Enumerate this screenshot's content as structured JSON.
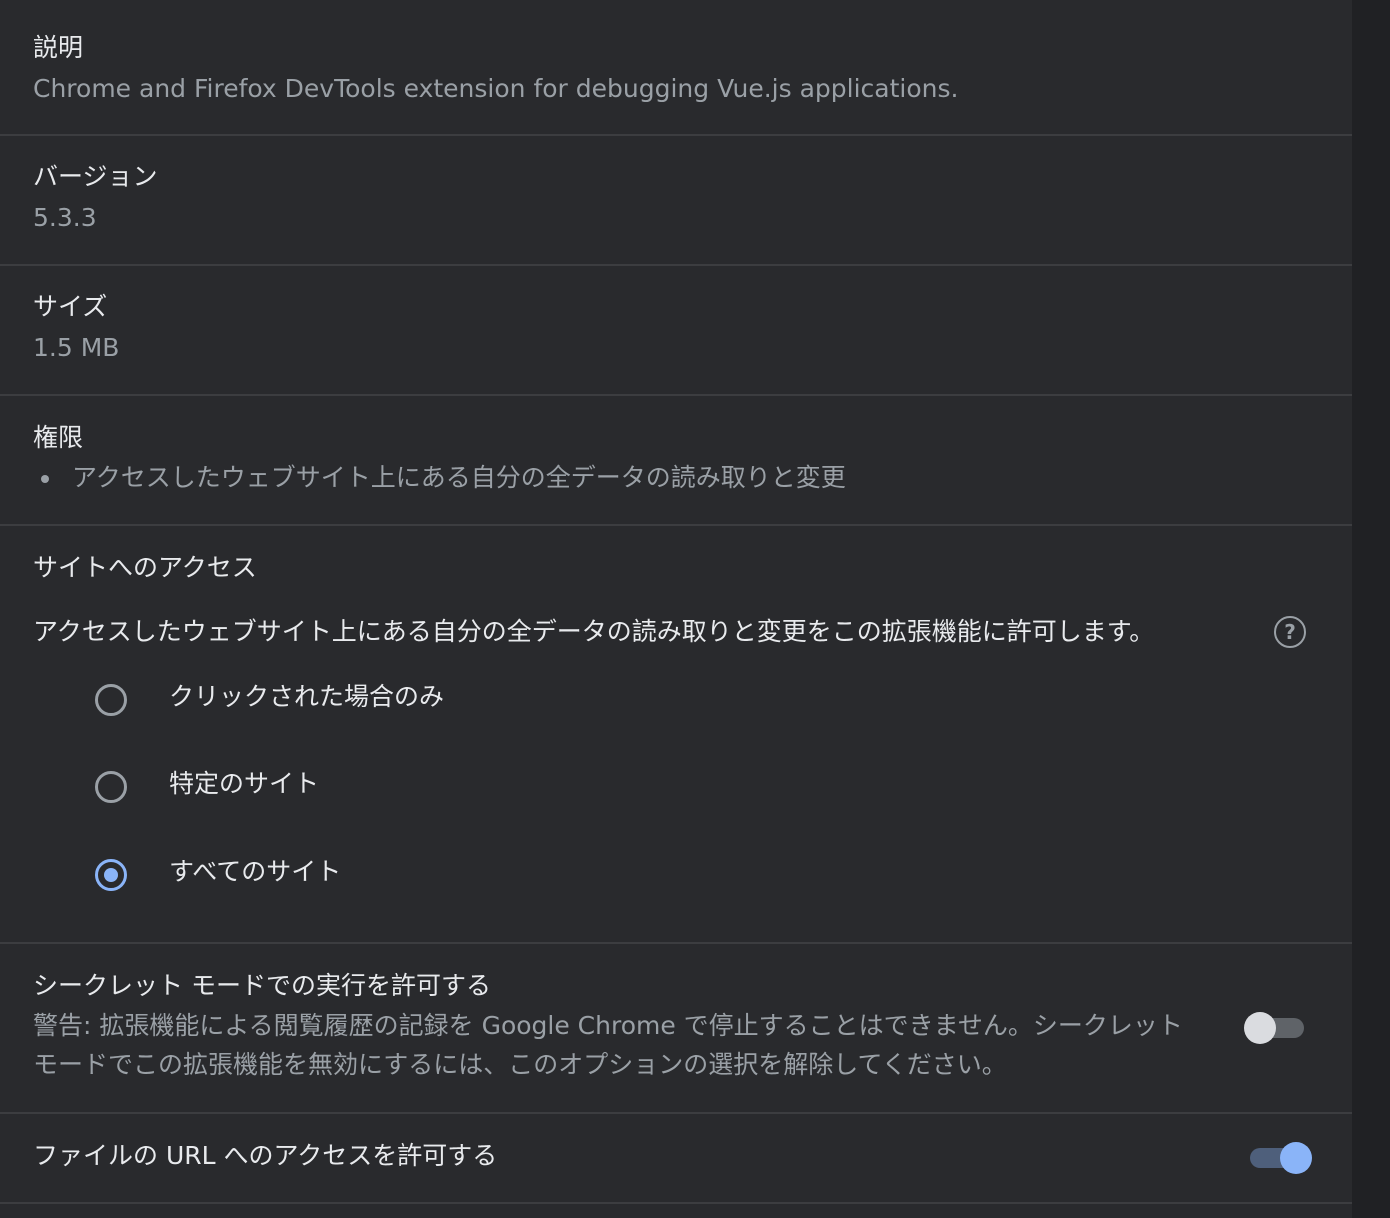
{
  "description": {
    "title": "説明",
    "text": "Chrome and Firefox DevTools extension for debugging Vue.js applications."
  },
  "version": {
    "title": "バージョン",
    "value": "5.3.3"
  },
  "size": {
    "title": "サイズ",
    "value": "1.5 MB"
  },
  "permissions": {
    "title": "権限",
    "items": [
      "アクセスしたウェブサイト上にある自分の全データの読み取りと変更"
    ]
  },
  "site_access": {
    "title": "サイトへのアクセス",
    "description": "アクセスしたウェブサイト上にある自分の全データの読み取りと変更をこの拡張機能に許可します。",
    "help_glyph": "?",
    "options": [
      {
        "label": "クリックされた場合のみ",
        "checked": false
      },
      {
        "label": "特定のサイト",
        "checked": false
      },
      {
        "label": "すべてのサイト",
        "checked": true
      }
    ]
  },
  "incognito": {
    "title": "シークレット モードでの実行を許可する",
    "warning_line1": "警告: 拡張機能による閲覧履歴の記録を Google Chrome で停止することはできません。シークレット",
    "warning_line2": "モードでこの拡張機能を無効にするには、このオプションの選択を解除してください。",
    "enabled": false
  },
  "file_urls": {
    "title": "ファイルの URL へのアクセスを許可する",
    "enabled": true
  },
  "colors": {
    "background": "#292a2d",
    "text_primary": "#e8eaed",
    "text_secondary": "#9aa0a6",
    "accent": "#8ab4f8",
    "divider": "#3c3d40"
  },
  "icons": {
    "help": "help-circle-icon",
    "bullet": "bullet-dot-icon"
  }
}
